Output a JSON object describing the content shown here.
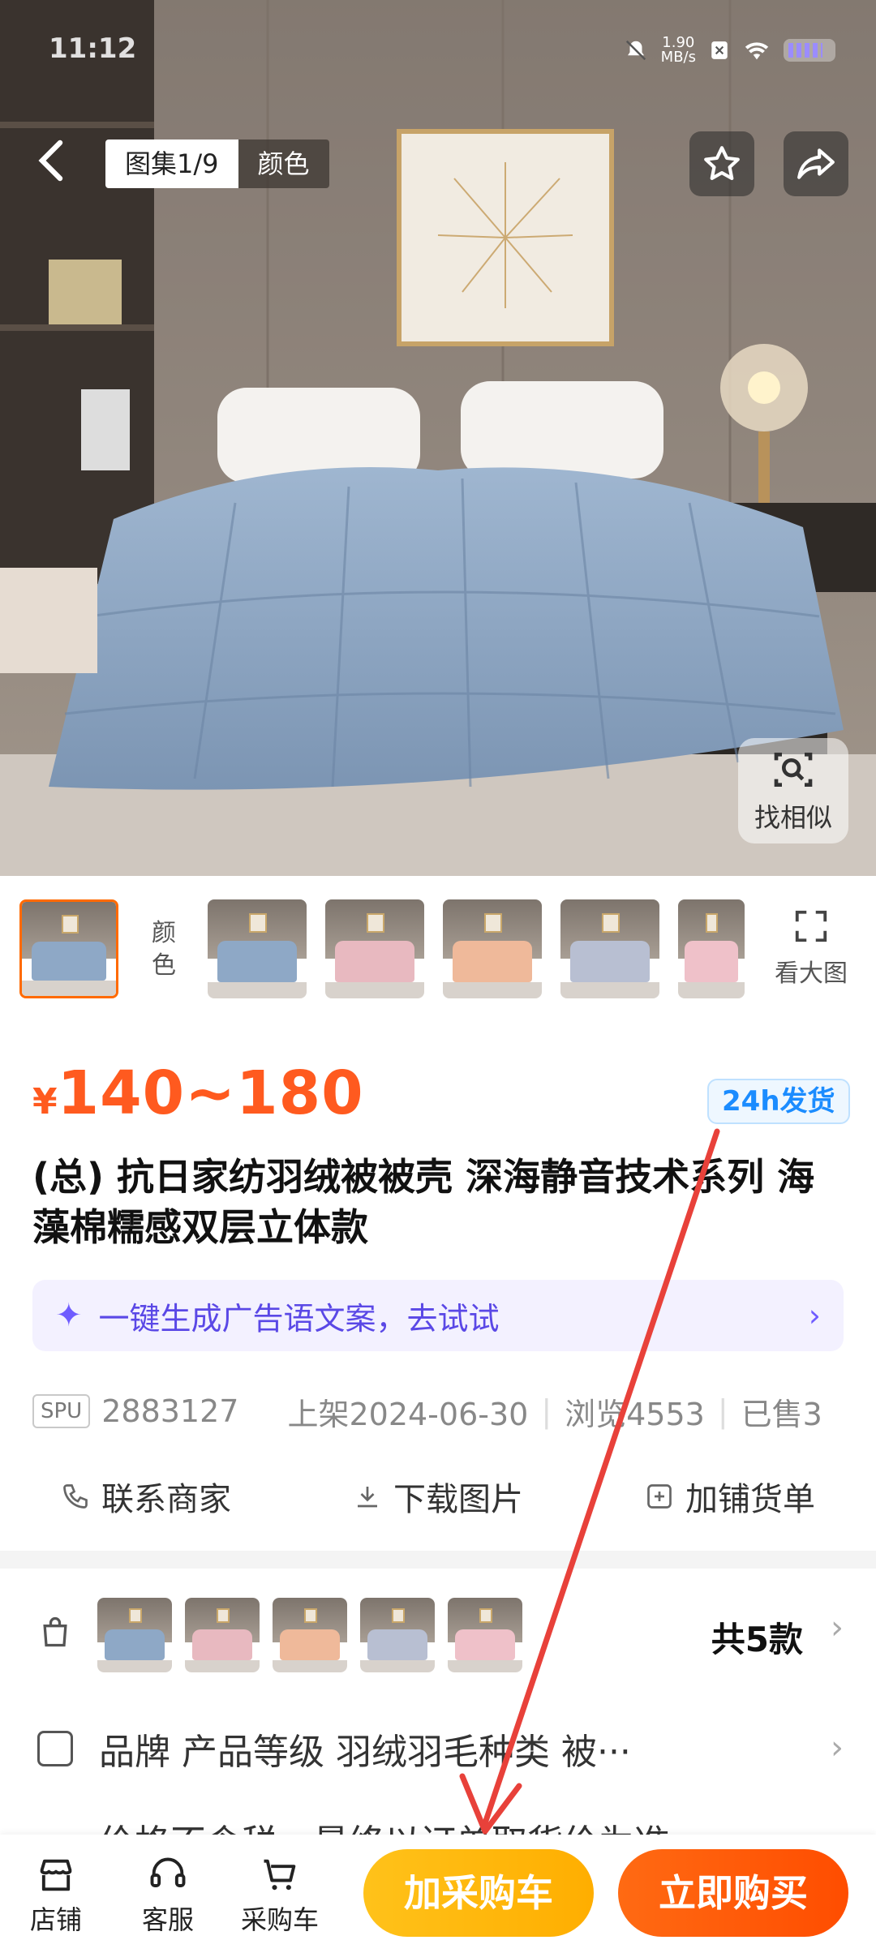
{
  "status_bar": {
    "time": "11:12",
    "speed_value": "1.90",
    "speed_unit": "MB/s"
  },
  "header": {
    "gallery_counter": "图集1/9",
    "gallery_tab_color": "颜色",
    "find_similar": "找相似"
  },
  "thumbnails": {
    "color_label": "颜色",
    "view_large": "看大图",
    "colors": [
      "#8ea8c6",
      "#8ea8c6",
      "#e8b9c0",
      "#efb99a",
      "#b8bfd2",
      "#efc1c9"
    ]
  },
  "product": {
    "currency": "¥",
    "price_range": "140~180",
    "ship_badge": "24h发货",
    "title": "(总) 抗日家纺羽绒被被壳 深海静音技术系列 海藻棉糯感双层立体款"
  },
  "ai_bar": {
    "text": "一键生成广告语文案，去试试"
  },
  "meta": {
    "spu_label": "SPU",
    "spu_value": "2883127",
    "listed": "上架2024-06-30",
    "views": "浏览4553",
    "sold": "已售3"
  },
  "actions": {
    "contact": "联系商家",
    "download": "下载图片",
    "add_to_list": "加铺货单"
  },
  "variants": {
    "colors": [
      "#8ea8c6",
      "#e8b9c0",
      "#efb99a",
      "#b8bfd2",
      "#efc1c9"
    ],
    "total": "共5款"
  },
  "attributes": {
    "text": "品牌  产品等级  羽绒羽毛种类  被···"
  },
  "partial_row": {
    "text": "价格不含税，最终以订单取货价为准"
  },
  "bottom_nav": {
    "store": "店铺",
    "service": "客服",
    "cart": "采购车",
    "add_cart": "加采购车",
    "buy_now": "立即购买"
  },
  "colors": {
    "accent": "#ff5a1f",
    "cart_button": "#ffb300",
    "buy_button": "#ff5a00",
    "annotation": "#e8413a"
  }
}
